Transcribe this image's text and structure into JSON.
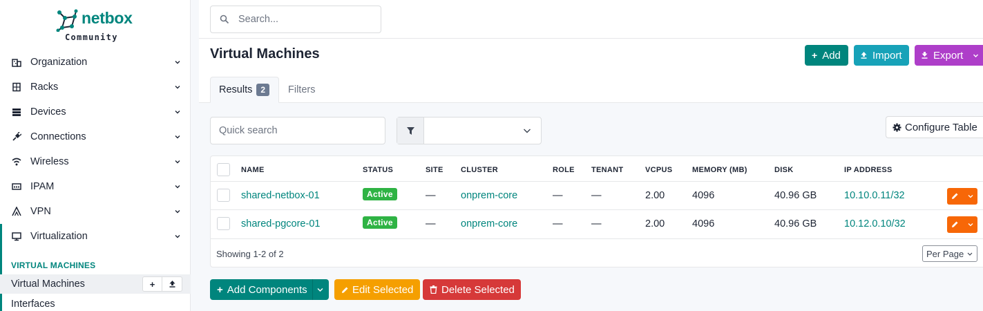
{
  "brand": {
    "name": "netbox",
    "edition": "Community"
  },
  "nav": [
    {
      "label": "Organization",
      "icon": "organization-icon"
    },
    {
      "label": "Racks",
      "icon": "rack-icon"
    },
    {
      "label": "Devices",
      "icon": "server-icon"
    },
    {
      "label": "Connections",
      "icon": "plug-icon"
    },
    {
      "label": "Wireless",
      "icon": "wifi-icon"
    },
    {
      "label": "IPAM",
      "icon": "counter-icon"
    },
    {
      "label": "VPN",
      "icon": "tunnel-icon"
    },
    {
      "label": "Virtualization",
      "icon": "monitor-icon"
    }
  ],
  "nav_section": "VIRTUAL MACHINES",
  "nav_sub": [
    {
      "label": "Virtual Machines"
    },
    {
      "label": "Interfaces"
    }
  ],
  "search": {
    "placeholder": "Search..."
  },
  "page": {
    "title": "Virtual Machines"
  },
  "header_buttons": {
    "add": "Add",
    "import": "Import",
    "export": "Export"
  },
  "tabs": {
    "results": "Results",
    "results_count": "2",
    "filters": "Filters"
  },
  "quick_search": {
    "placeholder": "Quick search"
  },
  "configure_table": "Configure Table",
  "table": {
    "columns": [
      "NAME",
      "STATUS",
      "SITE",
      "CLUSTER",
      "ROLE",
      "TENANT",
      "VCPUS",
      "MEMORY (MB)",
      "DISK",
      "IP ADDRESS"
    ],
    "rows": [
      {
        "name": "shared-netbox-01",
        "status": "Active",
        "site": "—",
        "cluster": "onprem-core",
        "role": "—",
        "tenant": "—",
        "vcpus": "2.00",
        "memory": "4096",
        "disk": "40.96 GB",
        "ip": "10.10.0.11/32"
      },
      {
        "name": "shared-pgcore-01",
        "status": "Active",
        "site": "—",
        "cluster": "onprem-core",
        "role": "—",
        "tenant": "—",
        "vcpus": "2.00",
        "memory": "4096",
        "disk": "40.96 GB",
        "ip": "10.12.0.10/32"
      }
    ],
    "showing": "Showing 1-2 of 2",
    "per_page": "Per Page"
  },
  "bulk_actions": {
    "add_components": "Add Components",
    "edit_selected": "Edit Selected",
    "delete_selected": "Delete Selected"
  },
  "colors": {
    "brand": "#00857d",
    "import": "#17a2b8",
    "export": "#ae3ec9",
    "active": "#2fb344",
    "edit": "#f76707",
    "edit_selected": "#f59f00",
    "delete": "#d63939"
  }
}
